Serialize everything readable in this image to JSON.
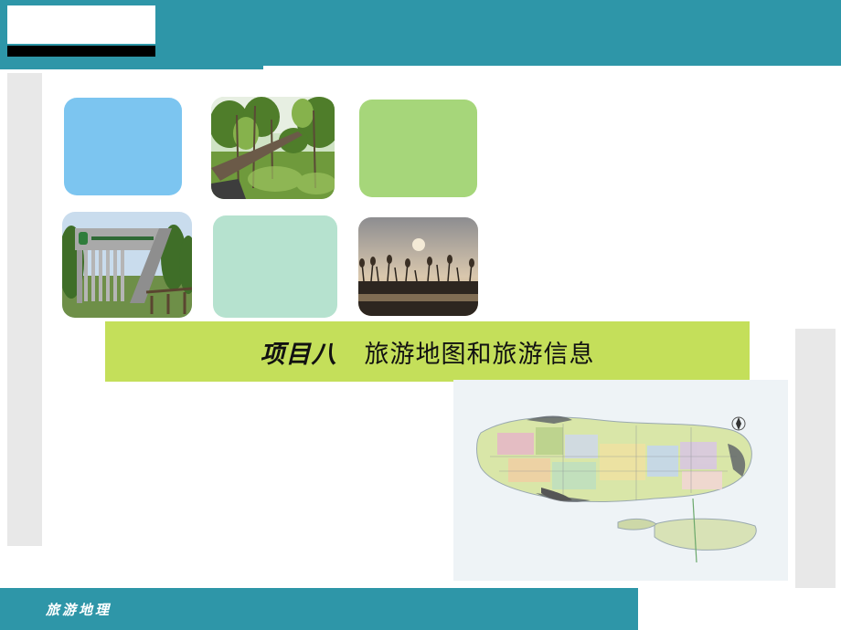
{
  "slide": {
    "title_prefix": "项目八",
    "title_main": "旅游地图和旅游信息",
    "footer": "旅游地理"
  },
  "colors": {
    "teal": "#2e96a8",
    "banner": "#c4df5a",
    "tile_blue": "#7cc5f0",
    "tile_green": "#a6d67a",
    "tile_mint": "#b6e2cf",
    "panel_gray": "#e8e8e8"
  },
  "images": [
    {
      "name": "forest-boardwalk-photo"
    },
    {
      "name": "park-gate-photo"
    },
    {
      "name": "reed-sunset-photo"
    },
    {
      "name": "island-map"
    }
  ]
}
